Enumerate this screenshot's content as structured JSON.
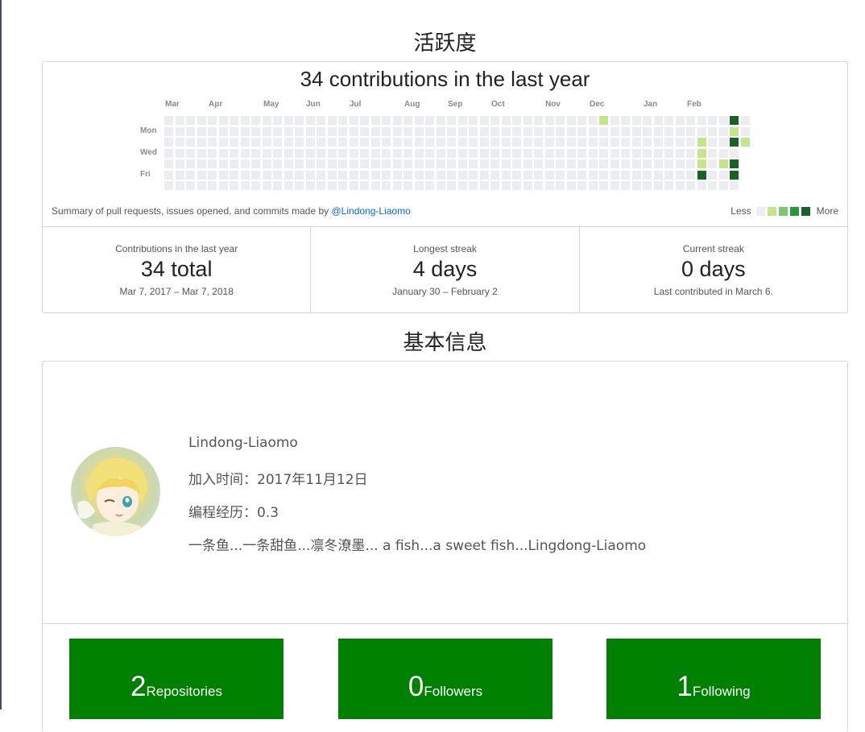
{
  "activity": {
    "title": "活跃度",
    "heading": "34 contributions in the last year",
    "months": [
      "Mar",
      "Apr",
      "May",
      "Jun",
      "Jul",
      "Aug",
      "Sep",
      "Oct",
      "Nov",
      "Dec",
      "Jan",
      "Feb"
    ],
    "day_labels": [
      "Mon",
      "Wed",
      "Fri"
    ],
    "summary_text": "Summary of pull requests, issues opened, and commits made by ",
    "summary_user": "@Lindong-Liaomo",
    "legend_less": "Less",
    "legend_more": "More",
    "legend_colors": [
      "#ebedf0",
      "#c6e48b",
      "#7bc96f",
      "#239a3b",
      "#196127"
    ],
    "stats": [
      {
        "label": "Contributions in the last year",
        "value": "34 total",
        "sub": "Mar 7, 2017 – Mar 7, 2018"
      },
      {
        "label": "Longest streak",
        "value": "4 days",
        "sub": "January 30 – February 2"
      },
      {
        "label": "Current streak",
        "value": "0 days",
        "sub": "Last contributed in March 6."
      }
    ]
  },
  "profile": {
    "title": "基本信息",
    "username": "Lindong-Liaomo",
    "joined": "加入时间：2017年11月12日",
    "experience": "编程经历：0.3",
    "bio": "一条鱼...一条甜鱼...凛冬潦墨... a fish...a sweet fish...Lingdong-Liaomo"
  },
  "counts": [
    {
      "number": "2",
      "label": "Repositories"
    },
    {
      "number": "0",
      "label": "Followers"
    },
    {
      "number": "1",
      "label": "Following"
    }
  ]
}
